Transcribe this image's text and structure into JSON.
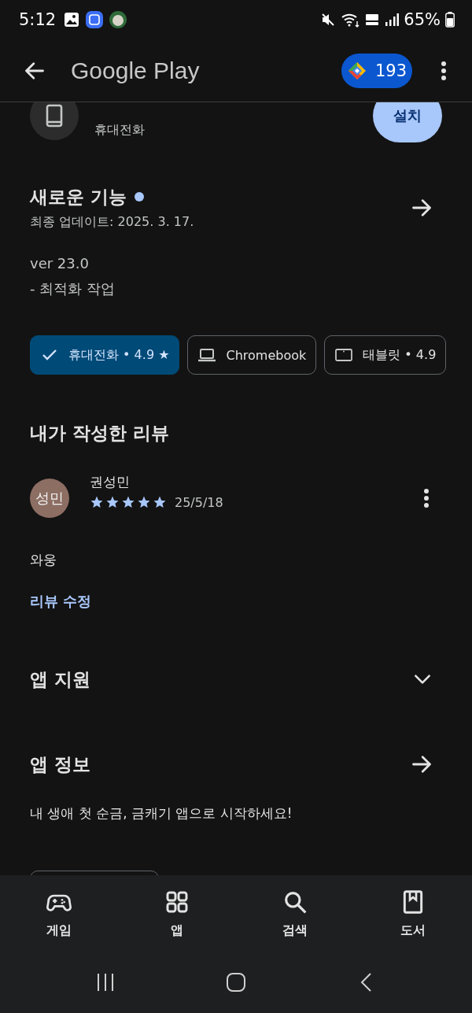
{
  "status_bar": {
    "time": "5:12",
    "battery": "65%"
  },
  "app_bar": {
    "title": "Google Play",
    "points": "193"
  },
  "app": {
    "subtitle": "휴대전화",
    "install": "설치"
  },
  "whats_new": {
    "title": "새로운 기능",
    "unread": true,
    "updated": "최종 업데이트: 2025. 3. 17.",
    "notes": [
      "ver 23.0",
      "- 최적화 작업"
    ]
  },
  "device_chips": [
    {
      "label": "휴대전화 • 4.9 ★",
      "selected": true
    },
    {
      "label": "Chromebook",
      "kind": "laptop",
      "selected": false
    },
    {
      "label": "태블릿 • 4.9",
      "kind": "tablet",
      "selected": false
    }
  ],
  "review": {
    "heading": "내가 작성한 리뷰",
    "avatar": "성민",
    "author": "권성민",
    "stars": 5,
    "date": "25/5/18",
    "text": "와웅",
    "edit_link": "리뷰 수정"
  },
  "sections": [
    {
      "title": "앱 지원",
      "kind": "expand"
    },
    {
      "title": "앱 정보",
      "kind": "arrow"
    }
  ],
  "about": "내 생애 첫 순금, 금캐기 앱으로 시작하세요!",
  "bottom_nav": [
    {
      "label": "게임",
      "kind": "games"
    },
    {
      "label": "앱",
      "kind": "apps"
    },
    {
      "label": "검색",
      "kind": "search"
    },
    {
      "label": "도서",
      "kind": "books"
    }
  ]
}
